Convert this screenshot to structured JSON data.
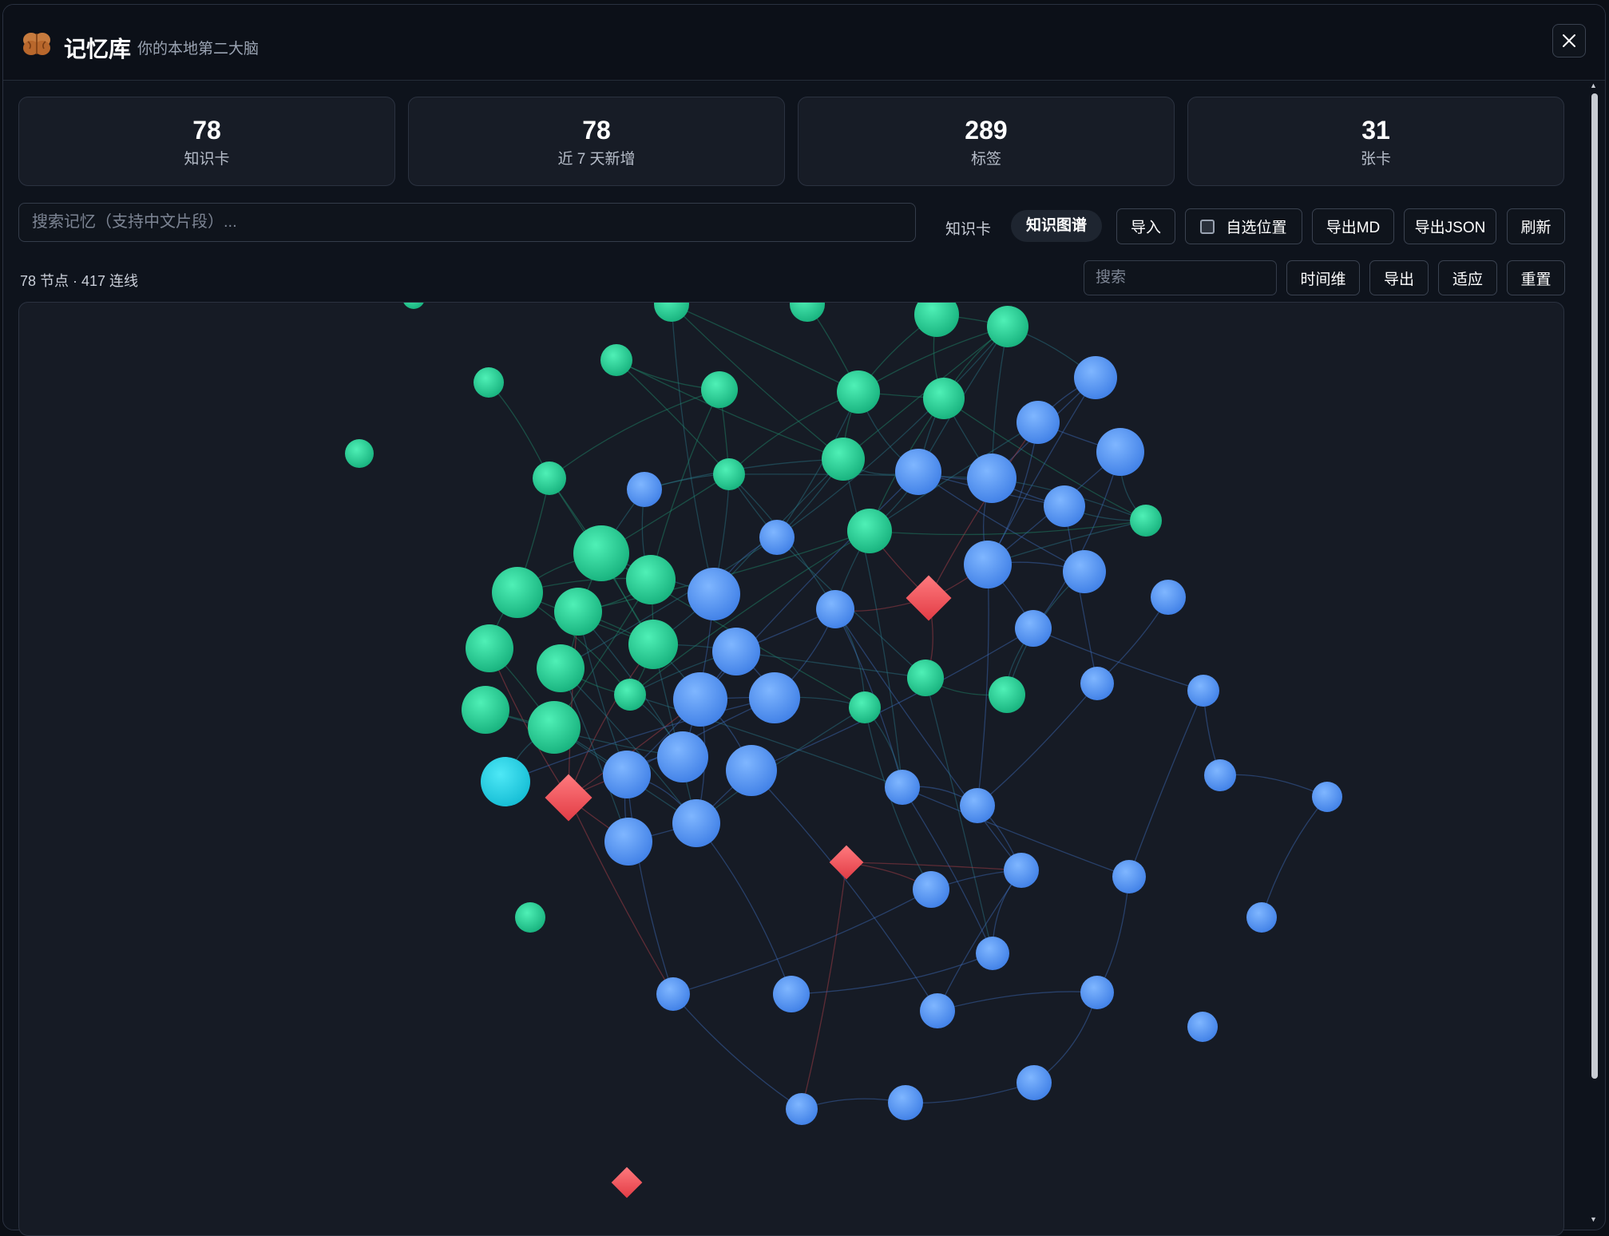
{
  "app": {
    "title": "记忆库",
    "subtitle": "你的本地第二大脑"
  },
  "stats": [
    {
      "value": "78",
      "label": "知识卡"
    },
    {
      "value": "78",
      "label": "近 7 天新增"
    },
    {
      "value": "289",
      "label": "标签"
    },
    {
      "value": "31",
      "label": "张卡"
    }
  ],
  "search": {
    "placeholder": "搜索记忆（支持中文片段）..."
  },
  "view_tabs": {
    "cards": "知识卡",
    "graph": "知识图谱"
  },
  "toolbar": {
    "import": "导入",
    "auto_layout": "自选位置",
    "export_md": "导出MD",
    "export_json": "导出JSON",
    "refresh": "刷新"
  },
  "graph_toolbar": {
    "summary": "78 节点 · 417 连线",
    "search_placeholder": "搜索",
    "timeline": "时间维",
    "export": "导出",
    "fit": "适应",
    "reset": "重置"
  },
  "colors": {
    "green": "#2fd49a",
    "blue": "#5b9cf8",
    "cyan": "#2ad4e8",
    "red": "#f0555c",
    "background": "#161b25"
  },
  "graph": {
    "node_count": 78,
    "edge_count": 417
  }
}
